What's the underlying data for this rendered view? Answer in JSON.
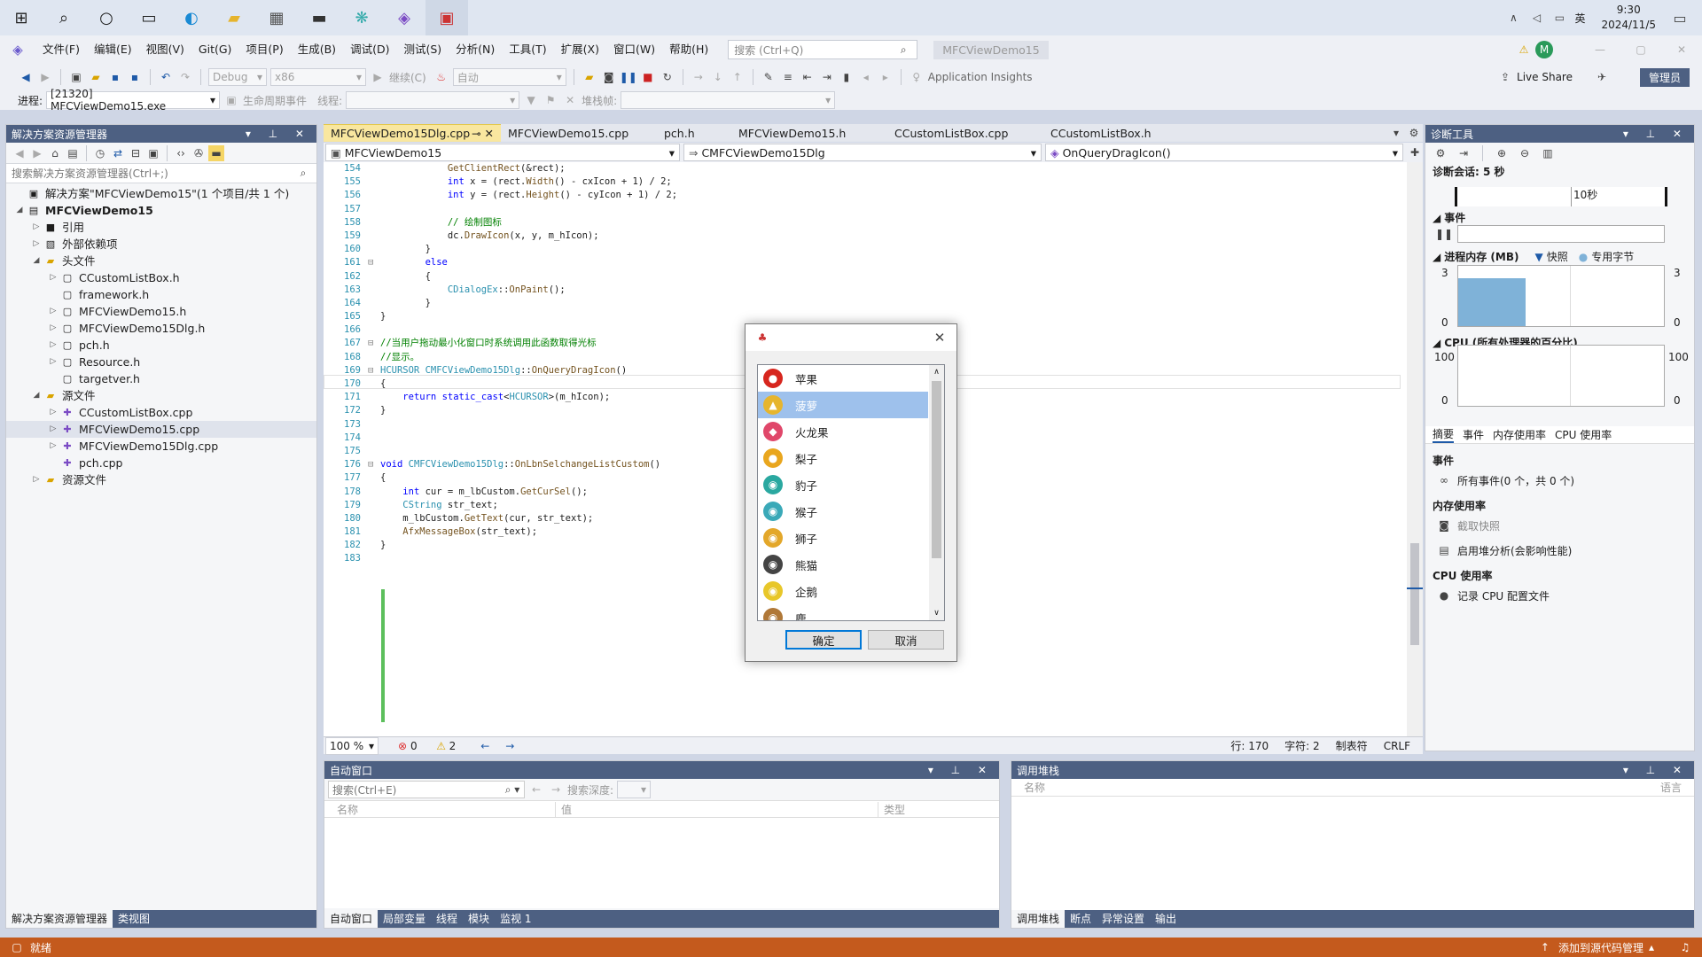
{
  "taskbar": {
    "icons": [
      "windows-icon",
      "search-icon",
      "cortana-icon",
      "task-view-icon",
      "edge-icon",
      "file-explorer-icon",
      "calculator-icon",
      "terminal-icon",
      "snipping-icon",
      "visual-studio-icon",
      "app-icon"
    ],
    "ime": "英",
    "time": "9:30",
    "date": "2024/11/5"
  },
  "titlebar": {
    "menus": [
      "文件(F)",
      "编辑(E)",
      "视图(V)",
      "Git(G)",
      "项目(P)",
      "生成(B)",
      "调试(D)",
      "测试(S)",
      "分析(N)",
      "工具(T)",
      "扩展(X)",
      "窗口(W)",
      "帮助(H)"
    ],
    "search_placeholder": "搜索 (Ctrl+Q)",
    "project_name": "MFCViewDemo15",
    "avatar": "M"
  },
  "toolbar1": {
    "config": "Debug",
    "platform": "x86",
    "continue": "继续(C)",
    "auto": "自动",
    "app_insights": "Application Insights",
    "live_share": "Live Share",
    "admin": "管理员"
  },
  "toolbar2": {
    "process_label": "进程:",
    "process_value": "[21320] MFCViewDemo15.exe",
    "lifecycle": "生命周期事件",
    "thread_label": "线程:",
    "stack_label": "堆栈帧:"
  },
  "solution": {
    "title": "解决方案资源管理器",
    "search_placeholder": "搜索解决方案资源管理器(Ctrl+;)",
    "items": [
      {
        "level": 0,
        "arrow": "",
        "icon": "▣",
        "label": "解决方案\"MFCViewDemo15\"(1 个项目/共 1 个)",
        "bold": false
      },
      {
        "level": 0,
        "arrow": "◢",
        "icon": "▤",
        "label": "MFCViewDemo15",
        "bold": true
      },
      {
        "level": 1,
        "arrow": "▷",
        "icon": "■",
        "label": "引用",
        "bold": false
      },
      {
        "level": 1,
        "arrow": "▷",
        "icon": "▧",
        "label": "外部依赖项",
        "bold": false
      },
      {
        "level": 1,
        "arrow": "◢",
        "icon": "▰",
        "label": "头文件",
        "bold": false
      },
      {
        "level": 2,
        "arrow": "▷",
        "icon": "▢",
        "label": "CCustomListBox.h",
        "bold": false
      },
      {
        "level": 2,
        "arrow": "",
        "icon": "▢",
        "label": "framework.h",
        "bold": false
      },
      {
        "level": 2,
        "arrow": "▷",
        "icon": "▢",
        "label": "MFCViewDemo15.h",
        "bold": false
      },
      {
        "level": 2,
        "arrow": "▷",
        "icon": "▢",
        "label": "MFCViewDemo15Dlg.h",
        "bold": false
      },
      {
        "level": 2,
        "arrow": "▷",
        "icon": "▢",
        "label": "pch.h",
        "bold": false
      },
      {
        "level": 2,
        "arrow": "▷",
        "icon": "▢",
        "label": "Resource.h",
        "bold": false
      },
      {
        "level": 2,
        "arrow": "",
        "icon": "▢",
        "label": "targetver.h",
        "bold": false
      },
      {
        "level": 1,
        "arrow": "◢",
        "icon": "▰",
        "label": "源文件",
        "bold": false
      },
      {
        "level": 2,
        "arrow": "▷",
        "icon": "✚",
        "label": "CCustomListBox.cpp",
        "bold": false
      },
      {
        "level": 2,
        "arrow": "▷",
        "icon": "✚",
        "label": "MFCViewDemo15.cpp",
        "bold": false
      },
      {
        "level": 2,
        "arrow": "▷",
        "icon": "✚",
        "label": "MFCViewDemo15Dlg.cpp",
        "bold": false
      },
      {
        "level": 2,
        "arrow": "",
        "icon": "✚",
        "label": "pch.cpp",
        "bold": false
      },
      {
        "level": 1,
        "arrow": "▷",
        "icon": "▰",
        "label": "资源文件",
        "bold": false
      }
    ],
    "selected_index": 14,
    "bottom_tabs": [
      "解决方案资源管理器",
      "类视图"
    ]
  },
  "editor": {
    "tabs": [
      "MFCViewDemo15Dlg.cpp",
      "MFCViewDemo15.cpp",
      "pch.h",
      "MFCViewDemo15.h",
      "CCustomListBox.cpp",
      "CCustomListBox.h"
    ],
    "nav": [
      "MFCViewDemo15",
      "CMFCViewDemo15Dlg",
      "OnQueryDragIcon()"
    ],
    "lines": [
      {
        "n": "154",
        "t": "            GetClientRect(&rect);"
      },
      {
        "n": "155",
        "t": "            int x = (rect.Width() - cxIcon + 1) / 2;"
      },
      {
        "n": "156",
        "t": "            int y = (rect.Height() - cyIcon + 1) / 2;"
      },
      {
        "n": "157",
        "t": ""
      },
      {
        "n": "158",
        "t": "            // 绘制图标"
      },
      {
        "n": "159",
        "t": "            dc.DrawIcon(x, y, m_hIcon);"
      },
      {
        "n": "160",
        "t": "        }"
      },
      {
        "n": "161",
        "t": "        else"
      },
      {
        "n": "162",
        "t": "        {"
      },
      {
        "n": "163",
        "t": "            CDialogEx::OnPaint();"
      },
      {
        "n": "164",
        "t": "        }"
      },
      {
        "n": "165",
        "t": "}"
      },
      {
        "n": "166",
        "t": ""
      },
      {
        "n": "167",
        "t": "//当用户拖动最小化窗口时系统调用此函数取得光标"
      },
      {
        "n": "168",
        "t": "//显示。"
      },
      {
        "n": "169",
        "t": "HCURSOR CMFCViewDemo15Dlg::OnQueryDragIcon()"
      },
      {
        "n": "170",
        "t": "{"
      },
      {
        "n": "171",
        "t": "    return static_cast<HCURSOR>(m_hIcon);"
      },
      {
        "n": "172",
        "t": "}"
      },
      {
        "n": "173",
        "t": ""
      },
      {
        "n": "174",
        "t": ""
      },
      {
        "n": "175",
        "t": ""
      },
      {
        "n": "176",
        "t": "void CMFCViewDemo15Dlg::OnLbnSelchangeListCustom()"
      },
      {
        "n": "177",
        "t": "{"
      },
      {
        "n": "178",
        "t": "    int cur = m_lbCustom.GetCurSel();"
      },
      {
        "n": "179",
        "t": "    CString str_text;"
      },
      {
        "n": "180",
        "t": "    m_lbCustom.GetText(cur, str_text);"
      },
      {
        "n": "181",
        "t": "    AfxMessageBox(str_text);"
      },
      {
        "n": "182",
        "t": "}"
      },
      {
        "n": "183",
        "t": ""
      }
    ],
    "status": {
      "zoom": "100 %",
      "errors": "0",
      "warnings": "2",
      "line": "行: 170",
      "col": "字符: 2",
      "tabs": "制表符",
      "eol": "CRLF"
    }
  },
  "dialog": {
    "items": [
      {
        "label": "苹果",
        "icon": "apple-icon",
        "glyph": "●",
        "color": "#d7261e"
      },
      {
        "label": "菠萝",
        "icon": "pineapple-icon",
        "glyph": "▲",
        "color": "#e6b52e"
      },
      {
        "label": "火龙果",
        "icon": "dragon-fruit-icon",
        "glyph": "◆",
        "color": "#e0476a"
      },
      {
        "label": "梨子",
        "icon": "pear-icon",
        "glyph": "●",
        "color": "#e9a61e"
      },
      {
        "label": "豹子",
        "icon": "leopard-icon",
        "glyph": "◉",
        "color": "#2aa8a0"
      },
      {
        "label": "猴子",
        "icon": "monkey-icon",
        "glyph": "◉",
        "color": "#3aa9b8"
      },
      {
        "label": "狮子",
        "icon": "lion-icon",
        "glyph": "◉",
        "color": "#e3a72a"
      },
      {
        "label": "熊猫",
        "icon": "panda-icon",
        "glyph": "◉",
        "color": "#444444"
      },
      {
        "label": "企鹅",
        "icon": "penguin-icon",
        "glyph": "◉",
        "color": "#e8c72a"
      },
      {
        "label": "鹿",
        "icon": "deer-icon",
        "glyph": "◉",
        "color": "#b07838"
      }
    ],
    "selected_index": 1,
    "ok": "确定",
    "cancel": "取消"
  },
  "diagnostic": {
    "title": "诊断工具",
    "session": "诊断会话: 5 秒",
    "timeline": "10秒",
    "events_label": "事件",
    "memory_label": "进程内存 (MB)",
    "snapshot": "快照",
    "private_bytes": "专用字节",
    "mem_max": "3",
    "mem_min": "0",
    "mem_fill": 0.8,
    "cpu_label": "CPU (所有处理器的百分比)",
    "cpu_max": "100",
    "cpu_min": "0",
    "tabs": [
      "摘要",
      "事件",
      "内存使用率",
      "CPU 使用率"
    ],
    "sec_events": "事件",
    "all_events": "所有事件(0 个，共 0 个)",
    "sec_memory": "内存使用率",
    "take_snapshot": "截取快照",
    "heap_analysis": "启用堆分析(会影响性能)",
    "sec_cpu": "CPU 使用率",
    "record_cpu": "记录 CPU 配置文件"
  },
  "autos": {
    "title": "自动窗口",
    "search_placeholder": "搜索(Ctrl+E)",
    "depth": "搜索深度:",
    "cols": [
      "名称",
      "值",
      "类型"
    ],
    "tabs": [
      "自动窗口",
      "局部变量",
      "线程",
      "模块",
      "监视 1"
    ]
  },
  "callstack": {
    "title": "调用堆栈",
    "cols": [
      "名称",
      "语言"
    ],
    "tabs": [
      "调用堆栈",
      "断点",
      "异常设置",
      "输出"
    ]
  },
  "statusbar": {
    "ready": "就绪",
    "source_control": "添加到源代码管理"
  }
}
